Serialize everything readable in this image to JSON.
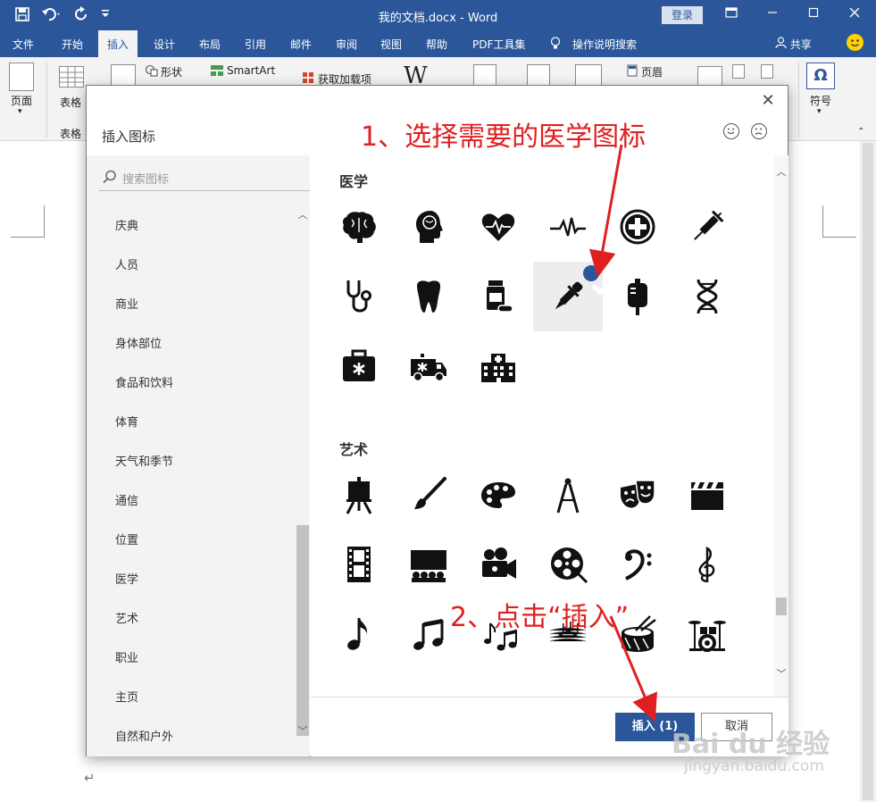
{
  "window": {
    "title": "我的文档.docx - Word",
    "login_label": "登录",
    "share_label": "共享"
  },
  "ribbon_tabs": [
    "文件",
    "开始",
    "插入",
    "设计",
    "布局",
    "引用",
    "邮件",
    "审阅",
    "视图",
    "帮助",
    "PDF工具集",
    "操作说明搜索"
  ],
  "ribbon": {
    "page_label": "页面",
    "table_label": "表格",
    "table_group": "表格",
    "shapes_label": "形状",
    "smartart_label": "SmartArt",
    "addins_label": "获取加载项",
    "wiki_label": "W",
    "header_label": "页眉",
    "symbol_label": "符号"
  },
  "dialog": {
    "title": "插入图标",
    "search_placeholder": "搜索图标",
    "categories": [
      "庆典",
      "人员",
      "商业",
      "身体部位",
      "食品和饮料",
      "体育",
      "天气和季节",
      "通信",
      "位置",
      "医学",
      "艺术",
      "职业",
      "主页",
      "自然和户外"
    ],
    "section_medical": "医学",
    "section_art": "艺术",
    "medical_icons": [
      "brain-icon",
      "head-brain-icon",
      "heartbeat-icon",
      "pulse-icon",
      "plus-cross-icon",
      "syringe-icon",
      "stethoscope-icon",
      "tooth-icon",
      "pill-bottle-icon",
      "dropper-icon",
      "iv-bag-icon",
      "dna-icon",
      "medical-kit-icon",
      "ambulance-icon",
      "hospital-icon"
    ],
    "art_icons": [
      "easel-icon",
      "paintbrush-icon",
      "palette-icon",
      "compass-icon",
      "theater-masks-icon",
      "clapperboard-icon",
      "film-strip-icon",
      "theater-seats-icon",
      "movie-camera-icon",
      "film-reel-icon",
      "bass-clef-icon",
      "treble-clef-icon",
      "eighth-note-icon",
      "beamed-notes-icon",
      "music-notes-icon",
      "sheet-music-icon",
      "drum-icon",
      "drum-kit-icon"
    ],
    "selected_icon": "dropper-icon",
    "insert_label": "插入 (1)",
    "cancel_label": "取消"
  },
  "annotations": {
    "step1": "1、选择需要的医学图标",
    "step2": "2、点击“插入”"
  },
  "watermark": {
    "brand": "Bai du 经验",
    "url": "jingyan.baidu.com"
  },
  "colors": {
    "accent": "#2b579a",
    "annotation": "#e02020"
  }
}
